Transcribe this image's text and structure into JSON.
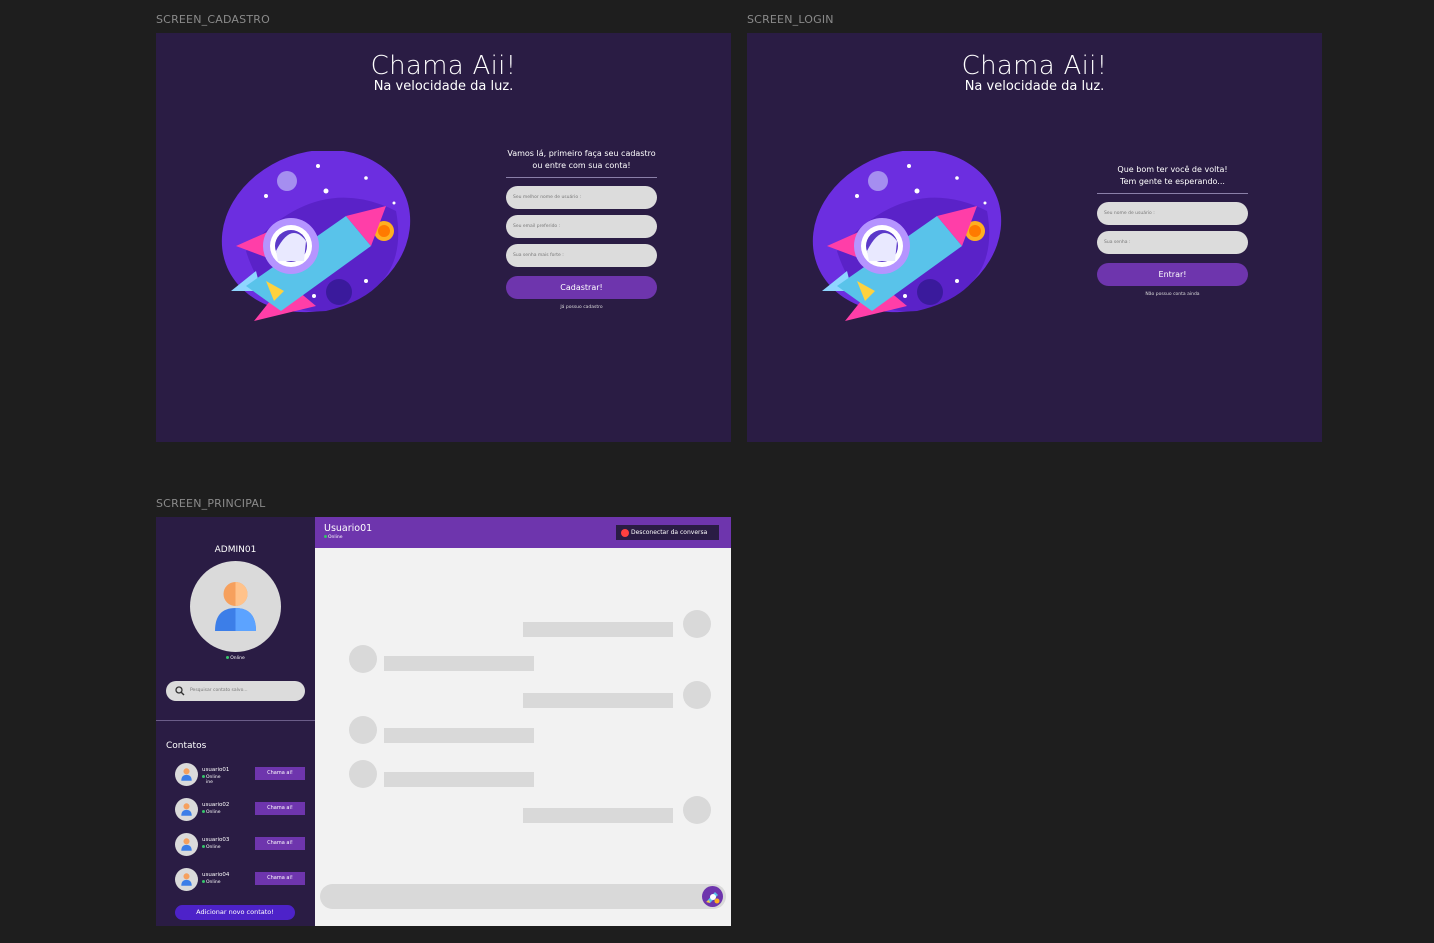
{
  "frames": {
    "cadastro": {
      "label": "SCREEN_CADASTRO",
      "title": "Chama Aii!",
      "subtitle": "Na velocidade da luz.",
      "intro_line1": "Vamos lá, primeiro faça seu cadastro",
      "intro_line2": "ou entre com sua conta!",
      "username_placeholder": "Seu melhor nome de usuário :",
      "email_placeholder": "Seu email preferido :",
      "password_placeholder": "Sua senha mais forte :",
      "submit_label": "Cadastrar!",
      "login_link": "Já possuo cadastro"
    },
    "login": {
      "label": "SCREEN_LOGIN",
      "title": "Chama Aii!",
      "subtitle": "Na velocidade da luz.",
      "intro_line1": "Que bom ter você de volta!",
      "intro_line2": "Tem gente te esperando...",
      "username_placeholder": "Seu nome de usuário :",
      "password_placeholder": "Sua senha :",
      "submit_label": "Entrar!",
      "signup_link": "Não possuo conta ainda"
    },
    "principal": {
      "label": "SCREEN_PRINCIPAL",
      "current_user": "ADMIN01",
      "current_status": "Online",
      "search_placeholder": "Pesquisar contato salvo...",
      "contacts_title": "Contatos",
      "contacts": [
        {
          "name": "usuario01",
          "status": "Online",
          "extra": "ine",
          "action": "Chama ai!"
        },
        {
          "name": "usuario02",
          "status": "Online",
          "action": "Chama ai!"
        },
        {
          "name": "usuario03",
          "status": "Online",
          "action": "Chama ai!"
        },
        {
          "name": "usuario04",
          "status": "Online",
          "action": "Chama ai!"
        }
      ],
      "add_contact": "Adicionar novo contato!",
      "chat": {
        "user": "Usuario01",
        "status": "Online",
        "disconnect": "Desconectar da conversa"
      }
    }
  },
  "colors": {
    "canvas": "#1e1e1e",
    "screen_bg": "#2a1c44",
    "accent": "#6e35ad",
    "add_button": "#4d22c9",
    "online": "#36c46b",
    "placeholder": "#d9d9d9"
  },
  "icons": [
    "rocket-illustration",
    "user-avatar-icon",
    "search-icon",
    "record-icon",
    "rocket-send-icon"
  ]
}
